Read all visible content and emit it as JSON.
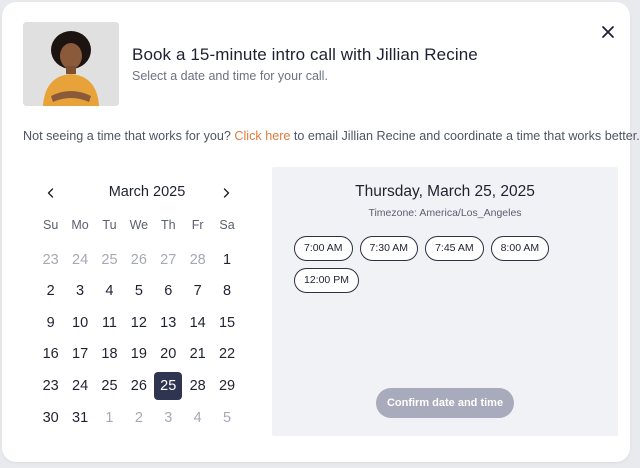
{
  "header": {
    "title": "Book a 15-minute intro call with Jillian Recine",
    "subtitle": "Select a date and time for your call."
  },
  "notice": {
    "prefix": "Not seeing a time that works for you? ",
    "link": "Click here",
    "suffix": " to email Jillian Recine and coordinate a time that works better."
  },
  "calendar": {
    "month_label": "March 2025",
    "weekdays": [
      "Su",
      "Mo",
      "Tu",
      "We",
      "Th",
      "Fr",
      "Sa"
    ],
    "weeks": [
      [
        {
          "d": "23",
          "muted": true
        },
        {
          "d": "24",
          "muted": true
        },
        {
          "d": "25",
          "muted": true
        },
        {
          "d": "26",
          "muted": true
        },
        {
          "d": "27",
          "muted": true
        },
        {
          "d": "28",
          "muted": true
        },
        {
          "d": "1"
        }
      ],
      [
        {
          "d": "2"
        },
        {
          "d": "3"
        },
        {
          "d": "4"
        },
        {
          "d": "5"
        },
        {
          "d": "6"
        },
        {
          "d": "7"
        },
        {
          "d": "8"
        }
      ],
      [
        {
          "d": "9"
        },
        {
          "d": "10"
        },
        {
          "d": "11"
        },
        {
          "d": "12"
        },
        {
          "d": "13"
        },
        {
          "d": "14"
        },
        {
          "d": "15"
        }
      ],
      [
        {
          "d": "16"
        },
        {
          "d": "17"
        },
        {
          "d": "18"
        },
        {
          "d": "19"
        },
        {
          "d": "20"
        },
        {
          "d": "21"
        },
        {
          "d": "22"
        }
      ],
      [
        {
          "d": "23"
        },
        {
          "d": "24"
        },
        {
          "d": "25"
        },
        {
          "d": "26"
        },
        {
          "d": "25",
          "selected": true
        },
        {
          "d": "28"
        },
        {
          "d": "29"
        }
      ],
      [
        {
          "d": "30"
        },
        {
          "d": "31"
        },
        {
          "d": "1",
          "muted": true
        },
        {
          "d": "2",
          "muted": true
        },
        {
          "d": "3",
          "muted": true
        },
        {
          "d": "4",
          "muted": true
        },
        {
          "d": "5",
          "muted": true
        }
      ]
    ]
  },
  "schedule": {
    "date_heading": "Thursday, March 25, 2025",
    "timezone": "Timezone: America/Los_Angeles",
    "slots": [
      "7:00 AM",
      "7:30 AM",
      "7:45 AM",
      "8:00 AM",
      "12:00 PM"
    ],
    "confirm_label": "Confirm date and time"
  },
  "icons": {
    "close": "close-icon",
    "prev": "chevron-left-icon",
    "next": "chevron-right-icon"
  },
  "colors": {
    "accent_link": "#e07a3c",
    "selected_day": "#2f3550",
    "confirm_disabled": "#a7abbb"
  }
}
